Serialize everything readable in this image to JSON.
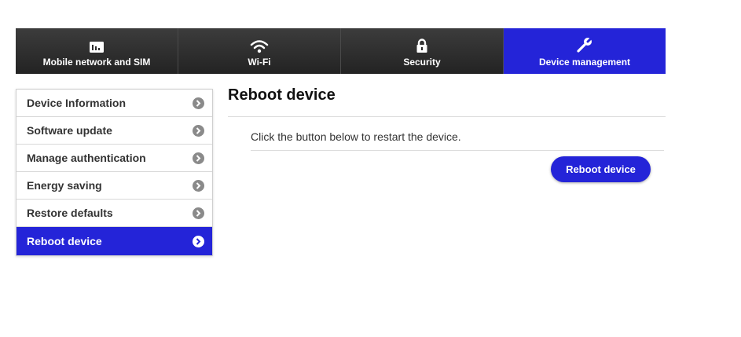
{
  "nav": {
    "tabs": [
      {
        "label": "Mobile network and SIM",
        "icon": "signal-sim-icon"
      },
      {
        "label": "Wi-Fi",
        "icon": "wifi-icon"
      },
      {
        "label": "Security",
        "icon": "lock-icon"
      },
      {
        "label": "Device management",
        "icon": "wrench-icon",
        "active": true
      }
    ]
  },
  "sidebar": {
    "items": [
      {
        "label": "Device Information"
      },
      {
        "label": "Software update"
      },
      {
        "label": "Manage authentication"
      },
      {
        "label": "Energy saving"
      },
      {
        "label": "Restore defaults"
      },
      {
        "label": "Reboot device",
        "active": true
      }
    ]
  },
  "main": {
    "title": "Reboot device",
    "description": "Click the button below to restart the device.",
    "button_label": "Reboot device"
  },
  "colors": {
    "accent": "#2424d8",
    "nav_dark": "#2f2f2f",
    "chevron_grey": "#8a8a8a"
  }
}
